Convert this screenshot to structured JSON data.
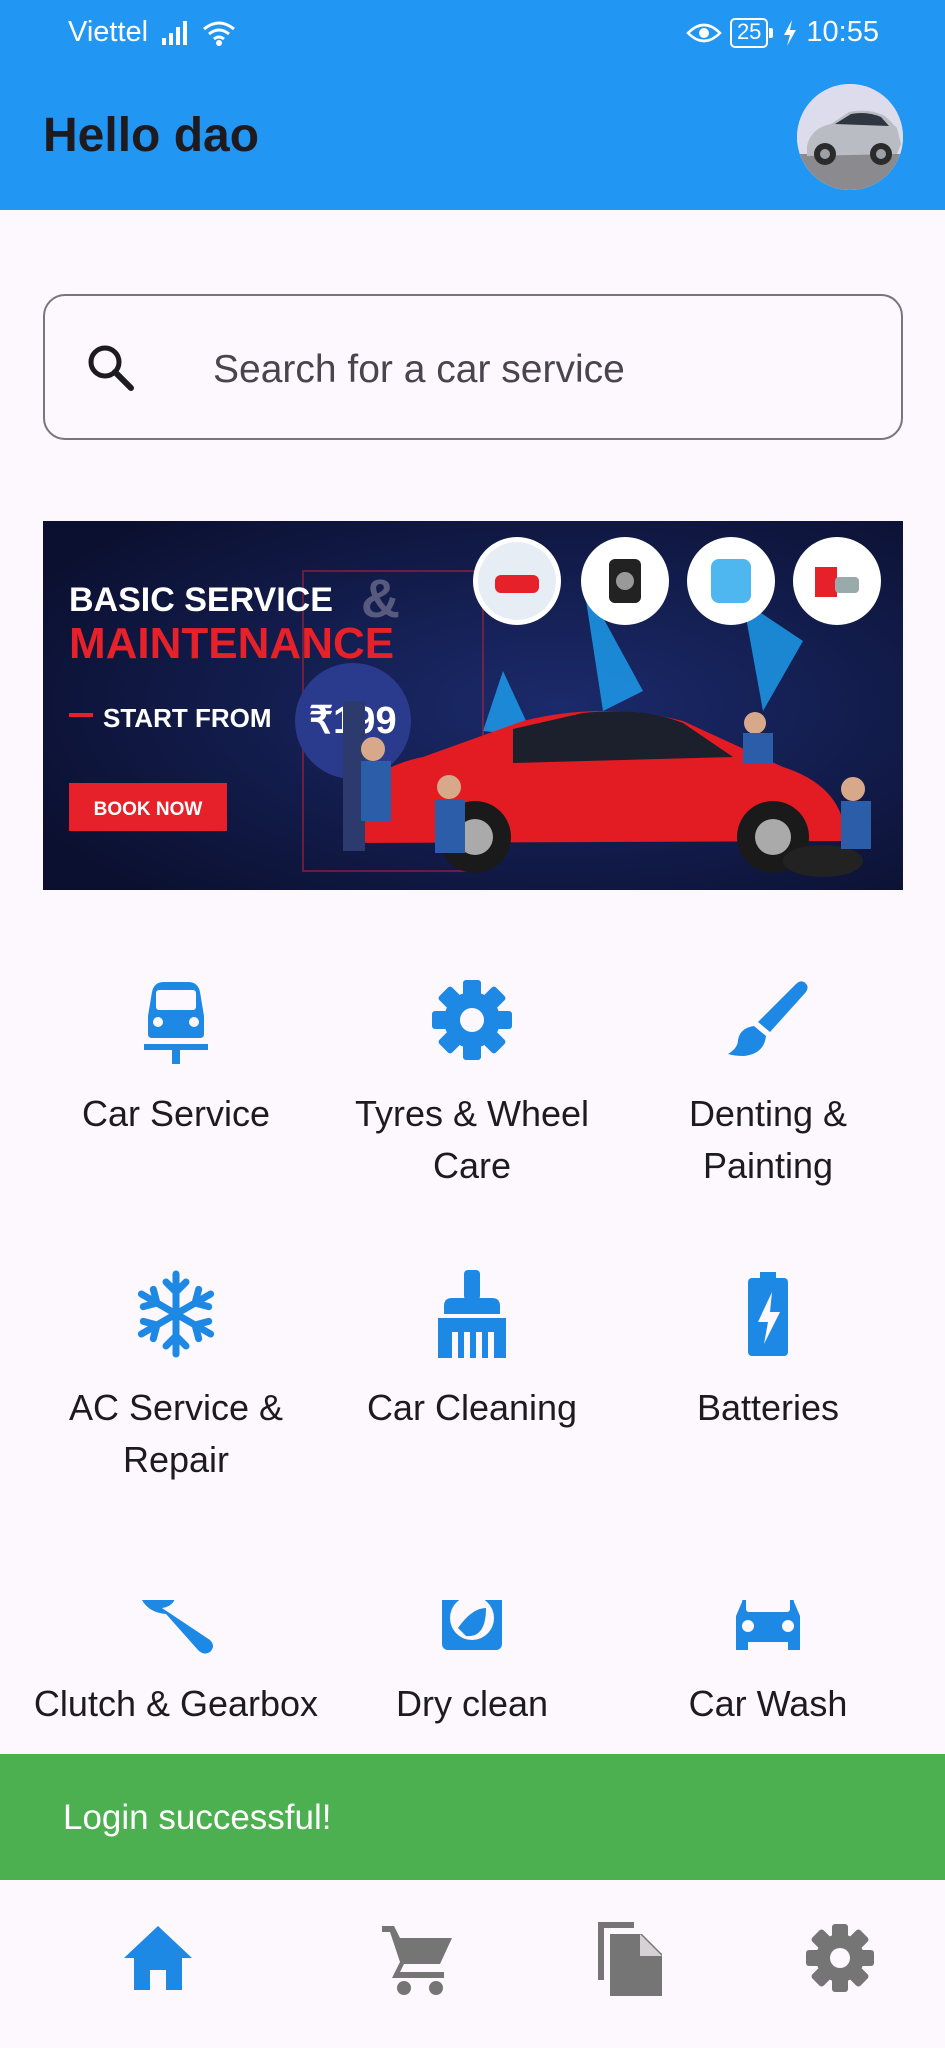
{
  "status_bar": {
    "carrier": "Viettel",
    "battery": "25",
    "time": "10:55"
  },
  "header": {
    "greeting": "Hello dao",
    "avatar_icon": "car-avatar"
  },
  "search": {
    "placeholder": "Search for a car service",
    "icon": "search-icon"
  },
  "banner": {
    "line1": "BASIC SERVICE",
    "line1_amp": "&",
    "line2": "MAINTENANCE",
    "line3": "START FROM",
    "price": "₹199",
    "cta": "BOOK NOW",
    "colors": {
      "background": "#0f1638",
      "accent": "#e62129",
      "car": "#e31b23"
    }
  },
  "services": [
    {
      "label": "Car Service",
      "icon": "car-lift-icon"
    },
    {
      "label": "Tyres & Wheel Care",
      "icon": "gear-icon"
    },
    {
      "label": "Denting & Painting",
      "icon": "brush-icon"
    },
    {
      "label": "AC Service & Repair",
      "icon": "snowflake-icon"
    },
    {
      "label": "Car Cleaning",
      "icon": "cleaning-brush-icon"
    },
    {
      "label": "Batteries",
      "icon": "battery-charging-icon"
    },
    {
      "label": "Clutch & Gearbox",
      "icon": "wrench-icon"
    },
    {
      "label": "Dry clean",
      "icon": "washing-machine-icon"
    },
    {
      "label": "Car Wash",
      "icon": "car-wash-icon"
    }
  ],
  "toast": {
    "message": "Login successful!",
    "color": "#4caf50"
  },
  "bottom_nav": [
    {
      "name": "home",
      "icon": "home-icon",
      "active": true
    },
    {
      "name": "cart",
      "icon": "cart-icon",
      "active": false
    },
    {
      "name": "orders",
      "icon": "documents-icon",
      "active": false
    },
    {
      "name": "settings",
      "icon": "gear-icon",
      "active": false
    }
  ],
  "colors": {
    "primary": "#2196f3",
    "icon_blue": "#1e88e5",
    "inactive_icon": "#757575"
  }
}
